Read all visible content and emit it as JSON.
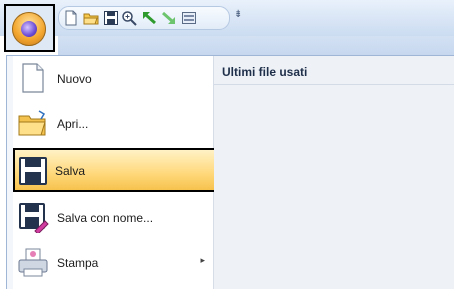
{
  "qat": {
    "icons": [
      "new-icon",
      "open-icon",
      "save-icon",
      "zoom-icon",
      "undo-icon",
      "redo-icon",
      "toolbar-icon"
    ],
    "more": "⇟"
  },
  "menu": {
    "recent_title": "Ultimi file usati",
    "items": [
      {
        "label": "Nuovo",
        "icon": "new-document-icon",
        "selected": false,
        "submenu": false
      },
      {
        "label": "Apri...",
        "icon": "open-folder-icon",
        "selected": false,
        "submenu": false
      },
      {
        "label": "Salva",
        "icon": "save-disk-icon",
        "selected": true,
        "submenu": false
      },
      {
        "label": "Salva con nome...",
        "icon": "save-as-icon",
        "selected": false,
        "submenu": false
      },
      {
        "label": "Stampa",
        "icon": "print-icon",
        "selected": false,
        "submenu": true
      }
    ],
    "submenu_arrow": "▸"
  }
}
